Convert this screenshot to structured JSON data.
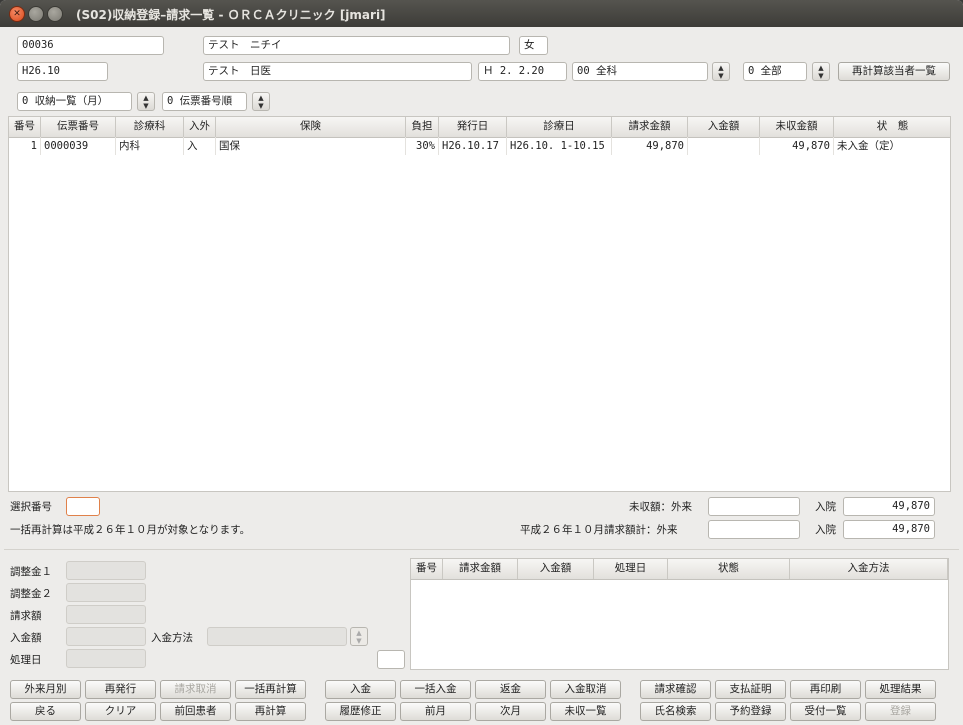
{
  "window": {
    "title": "(S02)収納登録–請求一覧 - ＯＲＣＡクリニック [jmari]"
  },
  "patient": {
    "id": "00036",
    "kana_name": "テスト　ニチイ",
    "sex": "女",
    "period": "H26.10",
    "name": "テスト　日医",
    "birth_date": "Ｈ 2. 2.20",
    "department": "00 全科",
    "scope": "0 全部",
    "recalc_list_button": "再計算該当者一覧"
  },
  "filters": {
    "list_type": "0 収納一覧（月）",
    "sort_order": "0 伝票番号順"
  },
  "main_table": {
    "headers": [
      "番号",
      "伝票番号",
      "診療科",
      "入外",
      "保険",
      "負担",
      "発行日",
      "診療日",
      "請求金額",
      "入金額",
      "未収金額",
      "状　態"
    ],
    "rows": [
      [
        "1",
        "0000039",
        "内科",
        "入",
        "国保",
        "30%",
        "H26.10.17",
        "H26.10. 1-10.15",
        "49,870",
        "",
        "49,870",
        "未入金（定）"
      ]
    ]
  },
  "summary": {
    "select_label": "選択番号",
    "select_value": "",
    "notice": "一括再計算は平成２６年１０月が対象となります。",
    "unpaid_label": "未収額：外来",
    "unpaid_outpatient": "",
    "inpatient_label": "入院",
    "unpaid_inpatient": "49,870",
    "billing_label": "平成２６年１０月請求額計：外来",
    "billing_outpatient": "",
    "inpatient_label2": "入院",
    "billing_inpatient": "49,870"
  },
  "adjust": {
    "labels": [
      "調整金１",
      "調整金２",
      "請求額",
      "入金額",
      "処理日"
    ],
    "method_label": "入金方法",
    "method_value": ""
  },
  "history_table": {
    "headers": [
      "番号",
      "請求金額",
      "入金額",
      "処理日",
      "状態",
      "入金方法"
    ]
  },
  "buttons": {
    "row1": [
      "外来月別",
      "再発行",
      "請求取消",
      "一括再計算",
      "入金",
      "一括入金",
      "返金",
      "入金取消",
      "請求確認",
      "支払証明",
      "再印刷",
      "処理結果"
    ],
    "row2": [
      "戻る",
      "クリア",
      "前回患者",
      "再計算",
      "履歴修正",
      "前月",
      "次月",
      "未収一覧",
      "氏名検索",
      "予約登録",
      "受付一覧",
      "登録"
    ]
  }
}
